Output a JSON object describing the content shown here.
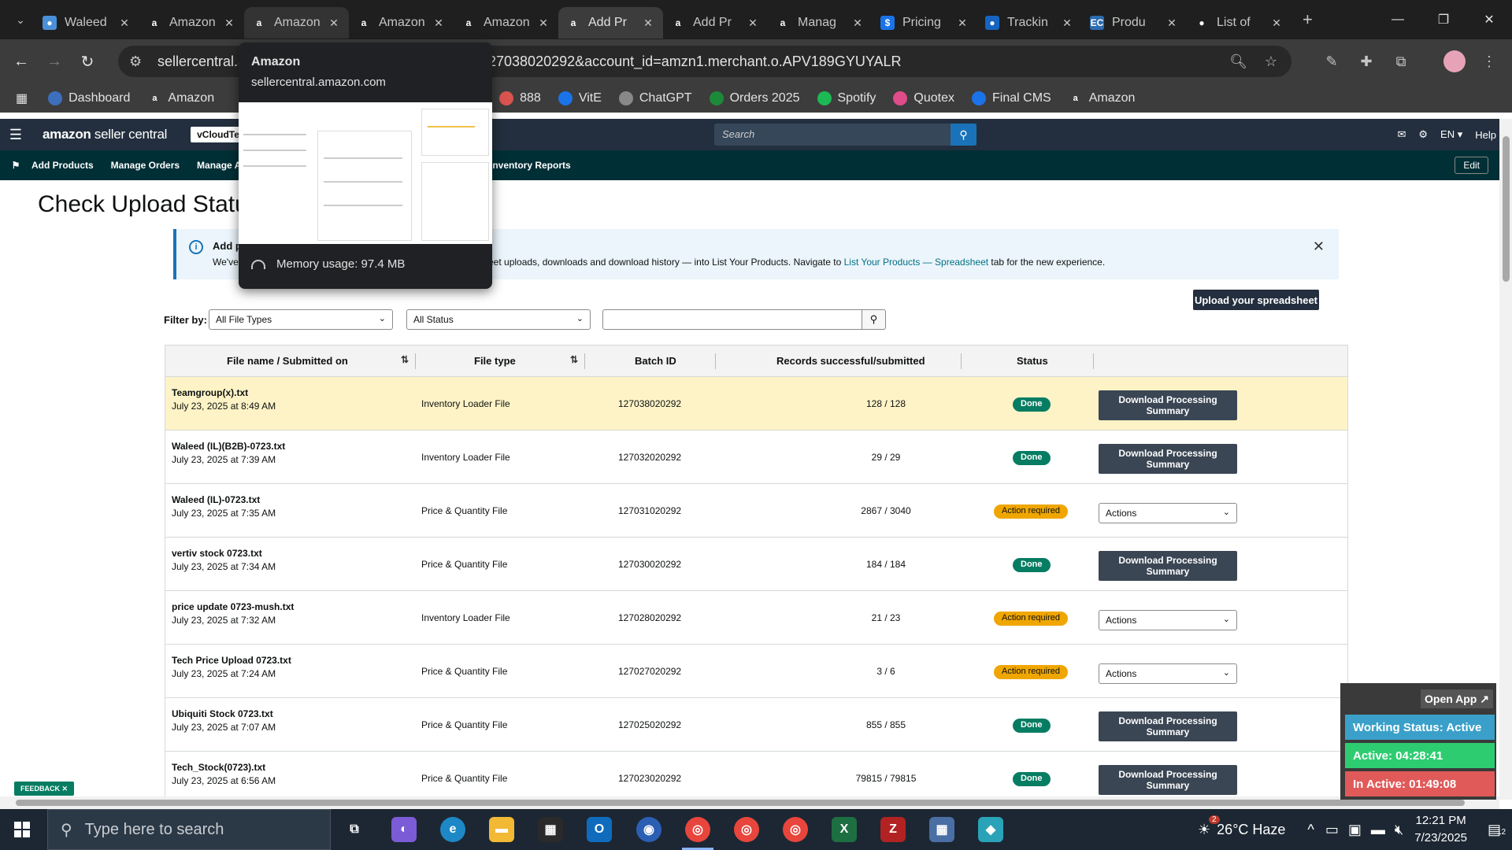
{
  "browser": {
    "tabs": [
      {
        "title": "Waleed",
        "favicon": "waleed-favicon",
        "color": "#4a90d9"
      },
      {
        "title": "Amazon",
        "favicon": "amazon-favicon",
        "color": "#ffffff"
      },
      {
        "title": "Amazon",
        "favicon": "amazon-favicon",
        "color": "#ffffff"
      },
      {
        "title": "Amazon",
        "favicon": "amazon-favicon",
        "color": "#ffffff"
      },
      {
        "title": "Amazon",
        "favicon": "amazon-favicon",
        "color": "#ffffff"
      },
      {
        "title": "Add Pr",
        "favicon": "amazon-favicon",
        "color": "#ffffff"
      },
      {
        "title": "Add Pr",
        "favicon": "amazon-favicon",
        "color": "#ffffff"
      },
      {
        "title": "Manag",
        "favicon": "amazon-favicon",
        "color": "#ffffff"
      },
      {
        "title": "Pricing",
        "favicon": "dollar-favicon",
        "color": "#1a73e8"
      },
      {
        "title": "Trackin",
        "favicon": "tracking-favicon",
        "color": "#1565c0"
      },
      {
        "title": "Produ",
        "favicon": "ec-favicon",
        "color": "#2c6cb0"
      },
      {
        "title": "List of",
        "favicon": "openai-favicon",
        "color": "#ffffff"
      }
    ],
    "url_host": "sellercentral.a",
    "url_rest": "27038020292&account_id=amzn1.merchant.o.APV189GYUYALR",
    "bookmarks": [
      {
        "label": "Dashboard",
        "color": "#3d6fbf"
      },
      {
        "label": "Amazon",
        "color": "#ffffff"
      },
      {
        "label": "888",
        "color": "#d9534f"
      },
      {
        "label": "VitE",
        "color": "#1a73e8"
      },
      {
        "label": "ChatGPT",
        "color": "#888888"
      },
      {
        "label": "Orders 2025",
        "color": "#1d8a3a"
      },
      {
        "label": "Spotify",
        "color": "#1db954"
      },
      {
        "label": "Quotex",
        "color": "#e04b8a"
      },
      {
        "label": "Final CMS",
        "color": "#1a73e8"
      },
      {
        "label": "Amazon",
        "color": "#ffffff"
      }
    ],
    "hovercard": {
      "title": "Amazon",
      "host": "sellercentral.amazon.com",
      "memory": "Memory usage: 97.4 MB"
    }
  },
  "seller_central": {
    "logo_main": "amazon",
    "logo_sub": " seller central",
    "store": "vCloudTech",
    "search_placeholder": "Search",
    "lang": "EN ▾",
    "help": "Help",
    "nav": [
      "Add Products",
      "Manage Orders",
      "Manage All Inve",
      "Inventory Reports"
    ],
    "edit": "Edit"
  },
  "page": {
    "title": "Check Upload Statu",
    "banner_title": "Add pr",
    "banner_text_pre": "We've",
    "banner_text_main": "eet uploads, downloads and download history — into List Your Products. Navigate to ",
    "banner_link": "List Your Products — Spreadsheet",
    "banner_text_post": " tab for the new experience.",
    "upload_button": "Upload your spreadsheet",
    "filter_label": "Filter by:",
    "filter_type": "All File Types",
    "filter_status": "All Status",
    "search_value": "",
    "columns": [
      "File name / Submitted on",
      "File type",
      "Batch ID",
      "Records successful/submitted",
      "Status"
    ],
    "download_label": "Download Processing Summary",
    "actions_label": "Actions",
    "rows": [
      {
        "name": "Teamgroup(x).txt",
        "date": "July 23, 2025 at 8:49 AM",
        "type": "Inventory Loader File",
        "batch": "127038020292",
        "records": "128 / 128",
        "status": "Done",
        "kind": "done"
      },
      {
        "name": "Waleed (IL)(B2B)-0723.txt",
        "date": "July 23, 2025 at 7:39 AM",
        "type": "Inventory Loader File",
        "batch": "127032020292",
        "records": "29 / 29",
        "status": "Done",
        "kind": "done"
      },
      {
        "name": "Waleed (IL)-0723.txt",
        "date": "July 23, 2025 at 7:35 AM",
        "type": "Price & Quantity File",
        "batch": "127031020292",
        "records": "2867 / 3040",
        "status": "Action required",
        "kind": "action"
      },
      {
        "name": "vertiv stock 0723.txt",
        "date": "July 23, 2025 at 7:34 AM",
        "type": "Price & Quantity File",
        "batch": "127030020292",
        "records": "184 / 184",
        "status": "Done",
        "kind": "done"
      },
      {
        "name": "price update 0723-mush.txt",
        "date": "July 23, 2025 at 7:32 AM",
        "type": "Inventory Loader File",
        "batch": "127028020292",
        "records": "21 / 23",
        "status": "Action required",
        "kind": "action"
      },
      {
        "name": "Tech Price Upload 0723.txt",
        "date": "July 23, 2025 at 7:24 AM",
        "type": "Price & Quantity File",
        "batch": "127027020292",
        "records": "3 / 6",
        "status": "Action required",
        "kind": "action"
      },
      {
        "name": "Ubiquiti Stock 0723.txt",
        "date": "July 23, 2025 at 7:07 AM",
        "type": "Price & Quantity File",
        "batch": "127025020292",
        "records": "855 / 855",
        "status": "Done",
        "kind": "done"
      },
      {
        "name": "Tech_Stock(0723).txt",
        "date": "July 23, 2025 at 6:56 AM",
        "type": "Price & Quantity File",
        "batch": "127023020292",
        "records": "79815 / 79815",
        "status": "Done",
        "kind": "done"
      }
    ],
    "feedback": "FEEDBACK ✕"
  },
  "tracker": {
    "open_app": "Open App ↗",
    "working": "Working Status: Active",
    "active": "Active: 04:28:41",
    "inactive": "In Active: 01:49:08",
    "colors": {
      "working": "#3aa0c9",
      "active": "#2ecc71",
      "inactive": "#e05a5a"
    }
  },
  "taskbar": {
    "search_placeholder": "Type here to search",
    "weather": "26°C  Haze",
    "weather_badge": "2",
    "time": "12:21 PM",
    "date": "7/23/2025",
    "notif_count": "12"
  }
}
